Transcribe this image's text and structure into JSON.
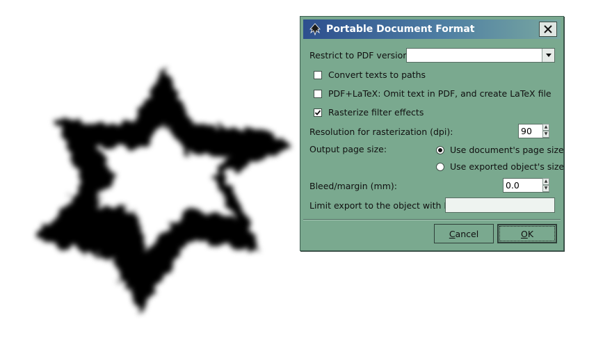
{
  "dialog": {
    "title": "Portable Document Format",
    "pdf_version_label": "Restrict to PDF version:",
    "pdf_version_value": "",
    "convert_texts_label": "Convert texts to paths",
    "convert_texts_checked": false,
    "pdf_latex_label": "PDF+LaTeX: Omit text in PDF, and create LaTeX file",
    "pdf_latex_checked": false,
    "rasterize_label": "Rasterize filter effects",
    "rasterize_checked": true,
    "resolution_label": "Resolution for rasterization (dpi):",
    "resolution_value": "90",
    "output_page_size_label": "Output page size:",
    "page_size_options": [
      {
        "label": "Use document's page size",
        "selected": true
      },
      {
        "label": "Use exported object's size",
        "selected": false
      }
    ],
    "bleed_label": "Bleed/margin (mm):",
    "bleed_value": "0.0",
    "limit_export_label": "Limit export to the object with ID:",
    "limit_export_value": "",
    "cancel_label": "Cancel",
    "cancel_mnemonic": "C",
    "cancel_rest": "ancel",
    "ok_label": "OK",
    "ok_mnemonic": "O",
    "ok_rest": "K"
  },
  "colors": {
    "dialog_bg": "#7aa98f",
    "title_gradient_start": "#2d4f8e",
    "title_gradient_end": "#79a8a0",
    "shape_fill": "#000000"
  },
  "icons": {
    "app": "inkscape-logo-icon",
    "close": "close-icon"
  }
}
